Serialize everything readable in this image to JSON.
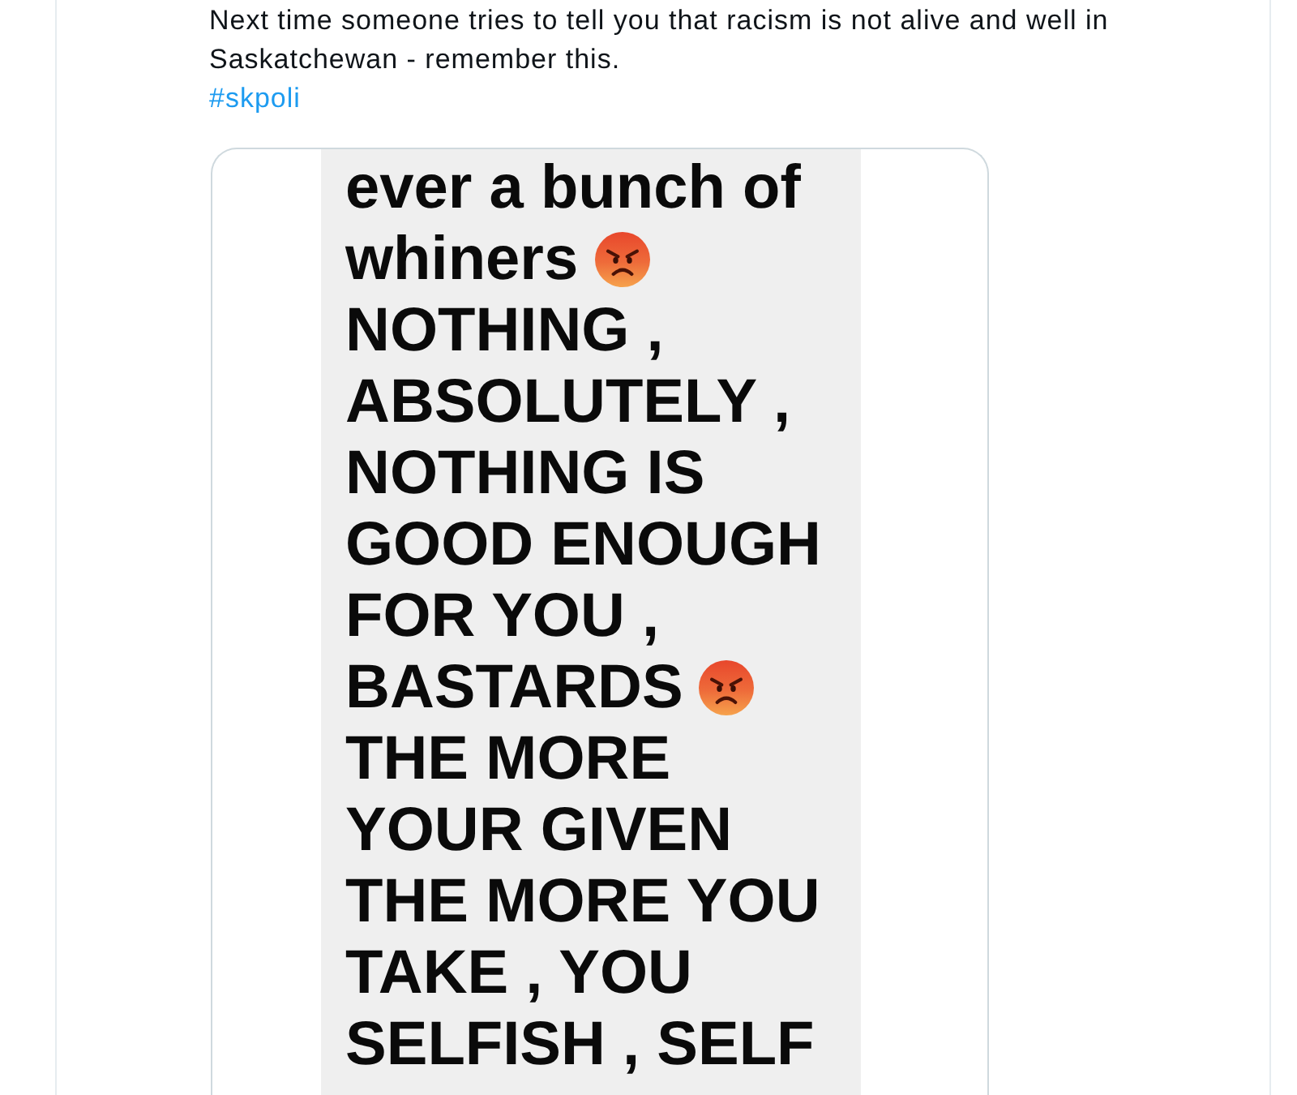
{
  "tweet": {
    "text": "Next time someone tries to tell you that racism is not alive and well in Saskatchewan - remember this.",
    "hashtag": "#skpoli"
  },
  "image": {
    "lines": [
      {
        "text": "ever a bunch of",
        "emoji": false
      },
      {
        "text": "whiners",
        "emoji": true
      },
      {
        "text": "NOTHING ,",
        "emoji": false
      },
      {
        "text": "ABSOLUTELY ,",
        "emoji": false
      },
      {
        "text": "NOTHING IS",
        "emoji": false
      },
      {
        "text": "GOOD ENOUGH",
        "emoji": false
      },
      {
        "text": "FOR YOU ,",
        "emoji": false
      },
      {
        "text": "BASTARDS",
        "emoji": true
      },
      {
        "text": "THE MORE",
        "emoji": false
      },
      {
        "text": "YOUR GIVEN",
        "emoji": false
      },
      {
        "text": "THE MORE YOU",
        "emoji": false
      },
      {
        "text": "TAKE , YOU",
        "emoji": false
      },
      {
        "text": "SELFISH , SELF",
        "emoji": false
      }
    ]
  }
}
